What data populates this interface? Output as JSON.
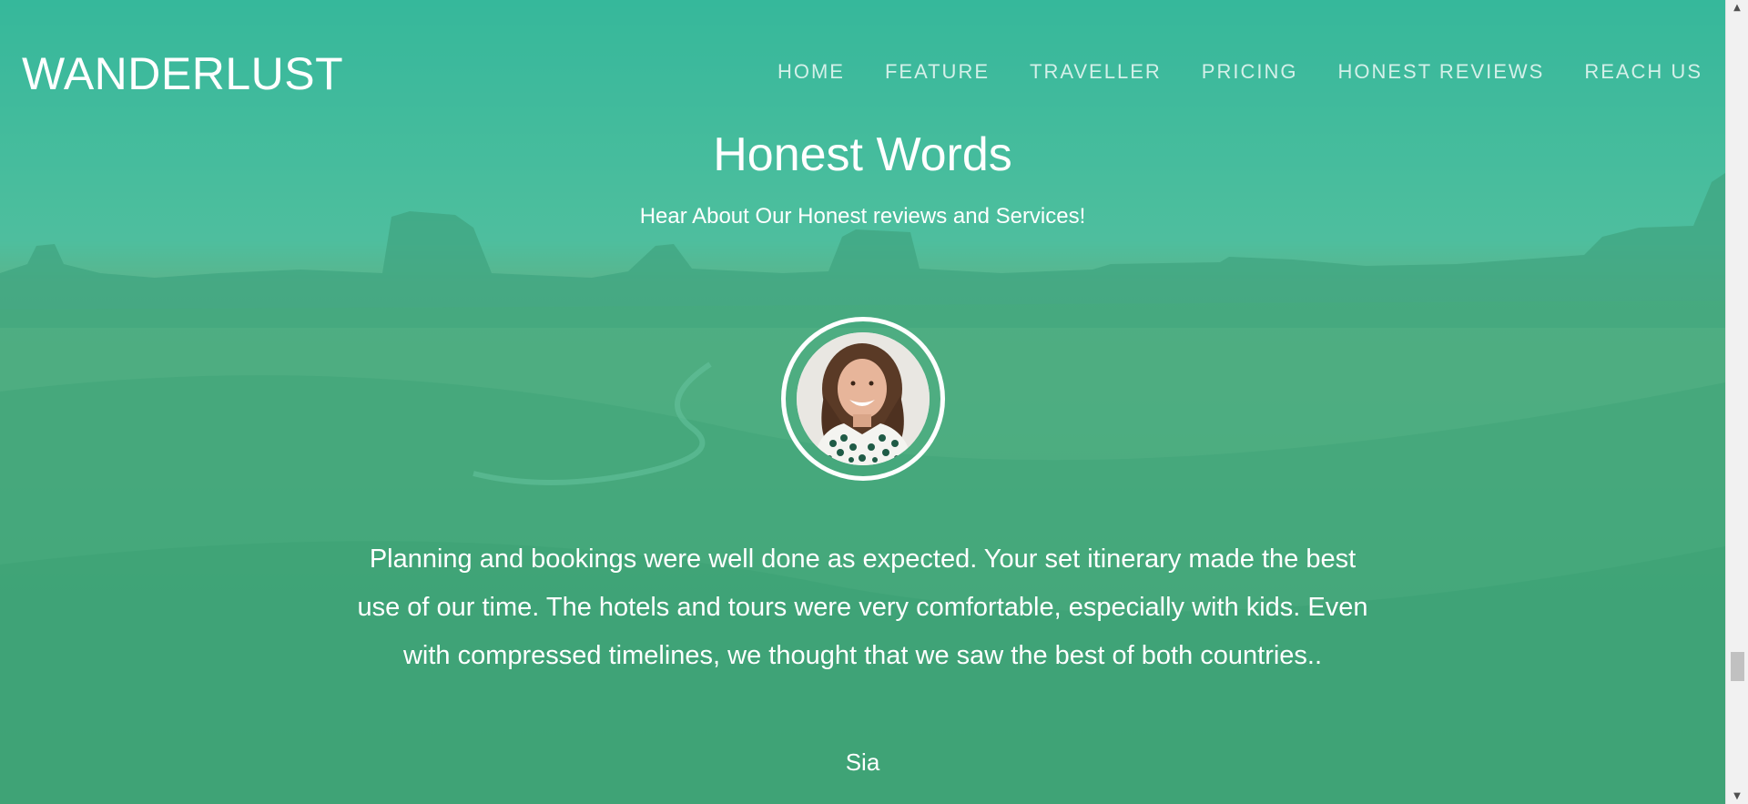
{
  "brand": "WANDERLUST",
  "nav": {
    "items": [
      {
        "label": "HOME"
      },
      {
        "label": "FEATURE"
      },
      {
        "label": "TRAVELLER"
      },
      {
        "label": "PRICING"
      },
      {
        "label": "HONEST REVIEWS"
      },
      {
        "label": "REACH US"
      }
    ]
  },
  "reviews": {
    "title": "Honest Words",
    "subtitle": "Hear About Our Honest reviews and Services!",
    "quote": "Planning and bookings were well done as expected. Your set itinerary made the best use of our time. The hotels and tours were very comfortable, especially with kids. Even with compressed timelines, we thought that we saw the best of both countries..",
    "reviewer": "Sia"
  },
  "colors": {
    "overlay": "#26c498",
    "text": "#ffffff",
    "nav_text": "#d8f3ea"
  },
  "icons": {
    "scroll_up": "scroll-up-arrow-icon",
    "scroll_down": "scroll-down-arrow-icon"
  }
}
